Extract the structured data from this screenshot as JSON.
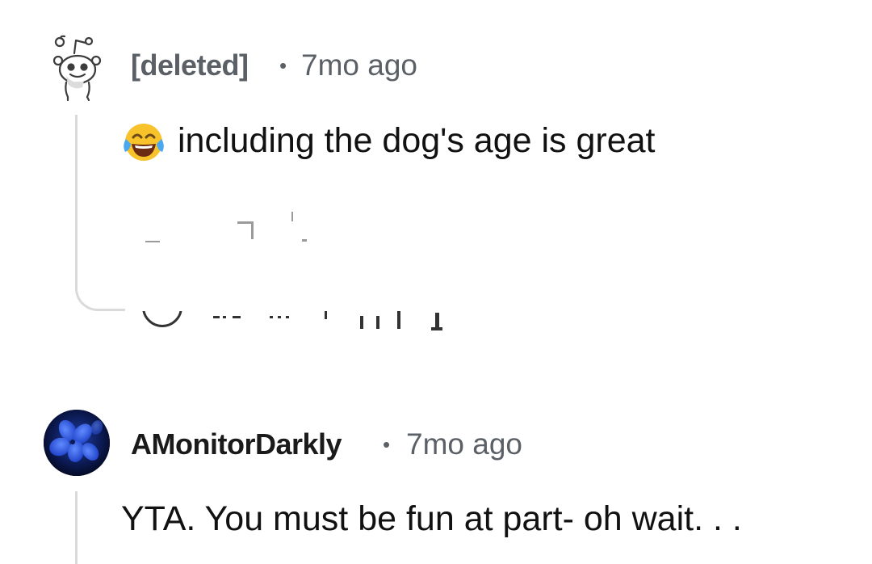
{
  "comments": [
    {
      "username": "[deleted]",
      "separator": "•",
      "time": "7mo ago",
      "emoji": "face-with-tears-of-joy",
      "text": "including the dog's age is great"
    },
    {
      "username": "AMonitorDarkly",
      "separator": "•",
      "time": "7mo ago",
      "text": "YTA. You must be fun at part- oh wait. . ."
    }
  ],
  "colors": {
    "username": "#1a1a1b",
    "meta": "#5b6066",
    "body": "#111111",
    "thread_line": "#d9dadb",
    "avatar_bg": "#0b1a4a",
    "avatar_flower": "#2a57e8"
  }
}
